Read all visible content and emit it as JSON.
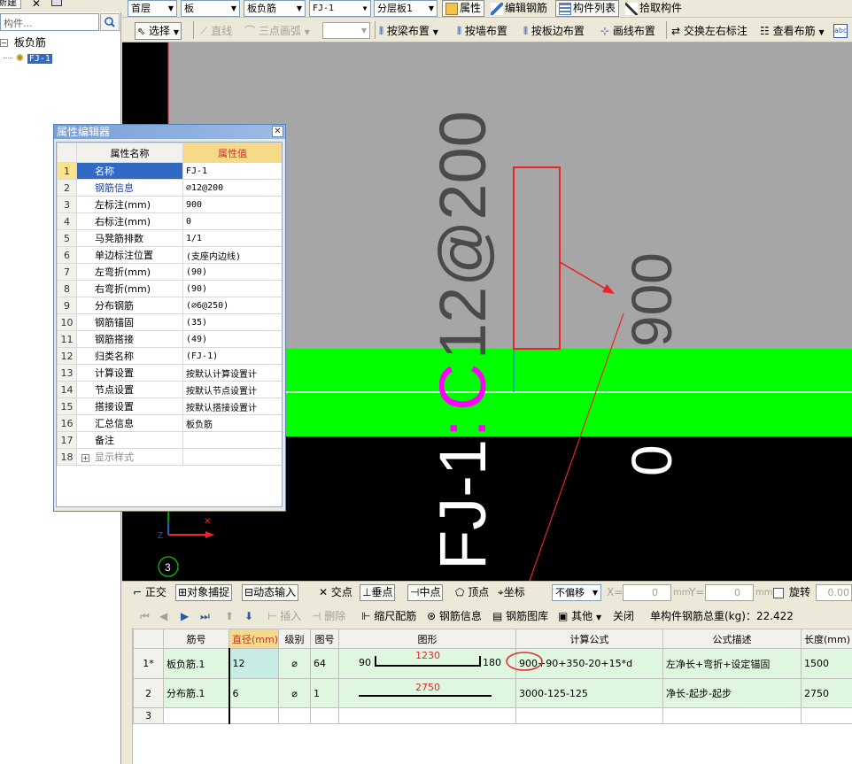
{
  "tree": {
    "new_label": "新建",
    "search_placeholder": "构件...",
    "category": "板负筋",
    "selected_item": "FJ-1"
  },
  "toolbar1": {
    "floor": "首层",
    "type": "板",
    "subtype": "板负筋",
    "component": "FJ-1",
    "layer": "分层板1",
    "btn_property": "属性",
    "btn_edit_rebar": "编辑钢筋",
    "btn_component_list": "构件列表",
    "btn_pick": "拾取构件"
  },
  "toolbar2": {
    "select": "选择",
    "line": "直线",
    "arc": "三点画弧",
    "by_beam": "按梁布置",
    "by_wall": "按墙布置",
    "by_slab_edge": "按板边布置",
    "by_line": "画线布置",
    "swap_labels": "交换左右标注",
    "view_layout": "查看布筋"
  },
  "canvas": {
    "text_label": "FJ-1:C12@200",
    "text_prefix": "FJ-1",
    "text_colon": ":",
    "text_grade": "C",
    "text_spec": "12@200",
    "text_left_mark": "900",
    "text_right_mark": "0",
    "axis_label": "3",
    "axis_z": "Z",
    "colors": {
      "top_band": "#a6a6a6",
      "green_band": "#00ff00",
      "bottom": "#000000",
      "magenta": "#ff00ff",
      "red": "#e8252a"
    }
  },
  "prop_editor": {
    "title": "属性编辑器",
    "col_name": "属性名称",
    "col_value": "属性值",
    "rows": [
      {
        "n": "1",
        "name": "名称",
        "value": "FJ-1"
      },
      {
        "n": "2",
        "name": "钢筋信息",
        "value": "⌀12@200"
      },
      {
        "n": "3",
        "name": "左标注(mm)",
        "value": "900"
      },
      {
        "n": "4",
        "name": "右标注(mm)",
        "value": "0"
      },
      {
        "n": "5",
        "name": "马凳筋排数",
        "value": "1/1"
      },
      {
        "n": "6",
        "name": "单边标注位置",
        "value": "(支座内边线)"
      },
      {
        "n": "7",
        "name": "左弯折(mm)",
        "value": "(90)"
      },
      {
        "n": "8",
        "name": "右弯折(mm)",
        "value": "(90)"
      },
      {
        "n": "9",
        "name": "分布钢筋",
        "value": "(⌀6@250)"
      },
      {
        "n": "10",
        "name": "钢筋锚固",
        "value": "(35)"
      },
      {
        "n": "11",
        "name": "钢筋搭接",
        "value": "(49)"
      },
      {
        "n": "12",
        "name": "归类名称",
        "value": "(FJ-1)"
      },
      {
        "n": "13",
        "name": "计算设置",
        "value": "按默认计算设置计"
      },
      {
        "n": "14",
        "name": "节点设置",
        "value": "按默认节点设置计"
      },
      {
        "n": "15",
        "name": "搭接设置",
        "value": "按默认搭接设置计"
      },
      {
        "n": "16",
        "name": "汇总信息",
        "value": "板负筋"
      },
      {
        "n": "17",
        "name": "备注",
        "value": ""
      },
      {
        "n": "18",
        "name": "显示样式",
        "value": ""
      }
    ]
  },
  "snapbar": {
    "ortho": "正交",
    "object_snap": "对象捕捉",
    "dynamic_input": "动态输入",
    "intersection": "交点",
    "perpendicular": "垂点",
    "midpoint": "中点",
    "vertex": "顶点",
    "coordinate": "坐标",
    "offset": "不偏移",
    "x_label": "X=",
    "x_value": "0",
    "y_label": "Y=",
    "y_value": "0",
    "unit": "mm",
    "rotate": "旋转",
    "rotate_value": "0.00"
  },
  "rebarbar": {
    "insert": "插入",
    "delete": "删除",
    "scale_rebar": "缩尺配筋",
    "rebar_info": "钢筋信息",
    "rebar_library": "钢筋图库",
    "other": "其他",
    "close": "关闭",
    "total_weight_label": "单构件钢筋总重(kg)：",
    "total_weight": "22.422"
  },
  "rebar_table": {
    "headers": [
      "",
      "筋号",
      "直径(mm)",
      "级别",
      "图号",
      "图形",
      "计算公式",
      "公式描述",
      "长度(mm)"
    ],
    "rows": [
      {
        "n": "1*",
        "name": "板负筋.1",
        "diameter": "12",
        "grade": "⌀",
        "fig": "64",
        "shape_left": "90",
        "shape_mid": "1230",
        "shape_right": "180",
        "formula": "900+90+350-20+15*d",
        "desc": "左净长+弯折+设定锚固",
        "length": "1500"
      },
      {
        "n": "2",
        "name": "分布筋.1",
        "diameter": "6",
        "grade": "⌀",
        "fig": "1",
        "shape_mid": "2750",
        "formula": "3000-125-125",
        "desc": "净长-起步-起步",
        "length": "2750"
      },
      {
        "n": "3",
        "name": "",
        "diameter": "",
        "grade": "",
        "fig": "",
        "formula": "",
        "desc": "",
        "length": ""
      }
    ]
  }
}
